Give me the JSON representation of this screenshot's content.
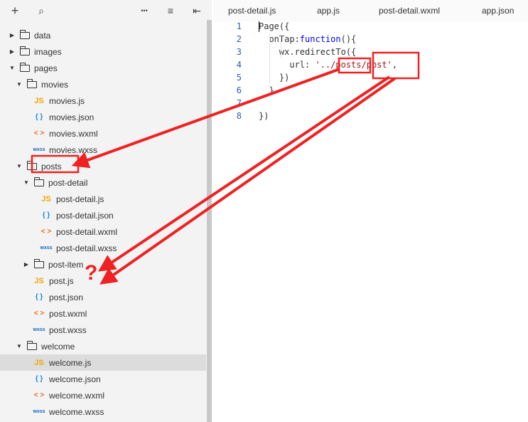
{
  "toolbar": {
    "add": "+",
    "search": "⌕",
    "more": "•••",
    "sort": "≡",
    "collapse": "⇤"
  },
  "tabs": [
    "post-detail.js",
    "app.js",
    "post-detail.wxml",
    "app.json"
  ],
  "tree": [
    {
      "label": "data",
      "type": "folder",
      "caret": "▶"
    },
    {
      "label": "images",
      "type": "folder",
      "caret": "▶"
    },
    {
      "label": "pages",
      "type": "folder",
      "caret": "▼"
    },
    {
      "label": "movies",
      "type": "folder",
      "caret": "▼"
    },
    {
      "label": "movies.js",
      "type": "js",
      "icon": "JS"
    },
    {
      "label": "movies.json",
      "type": "json",
      "icon": "{ }"
    },
    {
      "label": "movies.wxml",
      "type": "wxml",
      "icon": "< >"
    },
    {
      "label": "movies.wxss",
      "type": "wxss",
      "icon": "wxss"
    },
    {
      "label": "posts",
      "type": "folder",
      "caret": "▼"
    },
    {
      "label": "post-detail",
      "type": "folder",
      "caret": "▼"
    },
    {
      "label": "post-detail.js",
      "type": "js",
      "icon": "JS"
    },
    {
      "label": "post-detail.json",
      "type": "json",
      "icon": "{ }"
    },
    {
      "label": "post-detail.wxml",
      "type": "wxml",
      "icon": "< >"
    },
    {
      "label": "post-detail.wxss",
      "type": "wxss",
      "icon": "wxss"
    },
    {
      "label": "post-item",
      "type": "folder",
      "caret": "▶"
    },
    {
      "label": "post.js",
      "type": "js",
      "icon": "JS"
    },
    {
      "label": "post.json",
      "type": "json",
      "icon": "{ }"
    },
    {
      "label": "post.wxml",
      "type": "wxml",
      "icon": "< >"
    },
    {
      "label": "post.wxss",
      "type": "wxss",
      "icon": "wxss"
    },
    {
      "label": "welcome",
      "type": "folder",
      "caret": "▼"
    },
    {
      "label": "welcome.js",
      "type": "js",
      "icon": "JS",
      "selected": true
    },
    {
      "label": "welcome.json",
      "type": "json",
      "icon": "{ }"
    },
    {
      "label": "welcome.wxml",
      "type": "wxml",
      "icon": "< >"
    },
    {
      "label": "welcome.wxss",
      "type": "wxss",
      "icon": "wxss"
    }
  ],
  "code": {
    "line_numbers": [
      "1",
      "2",
      "3",
      "4",
      "5",
      "6",
      "7",
      "8"
    ],
    "lines": [
      [
        {
          "t": "Page({",
          "c": ""
        }
      ],
      [
        {
          "t": "  onTap:",
          "c": ""
        },
        {
          "t": "function",
          "c": "kw"
        },
        {
          "t": "(){",
          "c": ""
        }
      ],
      [
        {
          "t": "    wx.redirectTo({",
          "c": ""
        }
      ],
      [
        {
          "t": "      url: ",
          "c": ""
        },
        {
          "t": "'../posts/post'",
          "c": "str"
        },
        {
          "t": ",",
          "c": ""
        }
      ],
      [
        {
          "t": "    })",
          "c": ""
        }
      ],
      [
        {
          "t": "  }",
          "c": ""
        }
      ],
      [
        {
          "t": "",
          "c": ""
        }
      ],
      [
        {
          "t": "})",
          "c": ""
        }
      ]
    ]
  },
  "annotation": {
    "question_mark": "?"
  },
  "colors": {
    "annotation": "#ee2222",
    "sidebar_bg": "#f3f3f3"
  }
}
